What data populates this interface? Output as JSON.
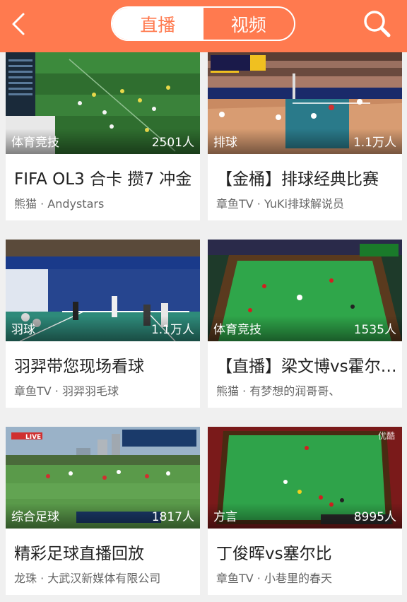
{
  "header": {
    "back_icon": "chevron-left-icon",
    "tabs": [
      {
        "label": "直播",
        "active": true
      },
      {
        "label": "视频",
        "active": false
      }
    ],
    "search_icon": "search-icon",
    "accent_color": "#ff7a4f"
  },
  "cards": [
    {
      "category": "体育竞技",
      "viewers": "2501人",
      "title": "FIFA OL3 合卡 攒7 冲金",
      "source": "熊猫 · Andystars",
      "thumb_label": ""
    },
    {
      "category": "排球",
      "viewers": "1.1万人",
      "title": "【金桶】排球经典比赛",
      "source": "章鱼TV · YuKi排球解说员",
      "thumb_label": ""
    },
    {
      "category": "羽球",
      "viewers": "1.1万人",
      "title": "羽羿带您现场看球",
      "source": "章鱼TV · 羽羿羽毛球",
      "thumb_label": ""
    },
    {
      "category": "体育竞技",
      "viewers": "1535人",
      "title": "【直播】梁文博vs霍尔…",
      "source": "熊猫 · 有梦想的润哥哥、",
      "thumb_label": ""
    },
    {
      "category": "综合足球",
      "viewers": "1817人",
      "title": "精彩足球直播回放",
      "source": "龙珠 · 大武汉新媒体有限公司",
      "thumb_label": "LIVE"
    },
    {
      "category": "方言",
      "viewers": "8995人",
      "title": "丁俊晖vs塞尔比",
      "source": "章鱼TV · 小巷里的春天",
      "thumb_label": "优酷"
    }
  ]
}
